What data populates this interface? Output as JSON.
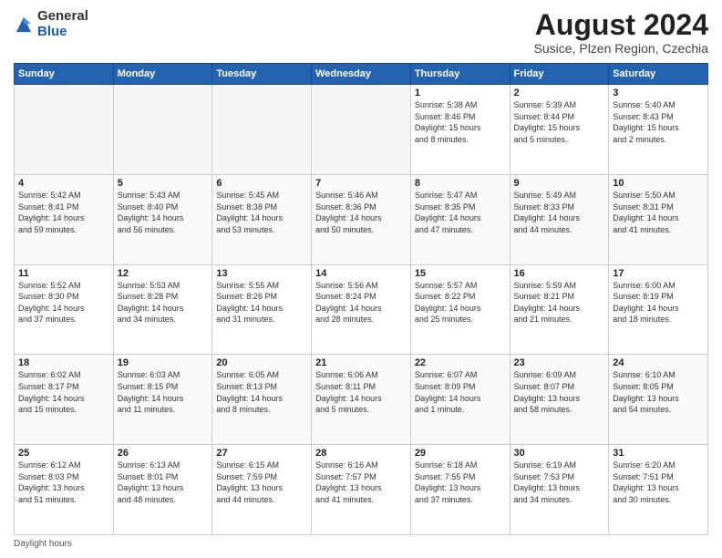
{
  "logo": {
    "general": "General",
    "blue": "Blue"
  },
  "title": "August 2024",
  "subtitle": "Susice, Plzen Region, Czechia",
  "days_of_week": [
    "Sunday",
    "Monday",
    "Tuesday",
    "Wednesday",
    "Thursday",
    "Friday",
    "Saturday"
  ],
  "footer": "Daylight hours",
  "weeks": [
    [
      {
        "day": "",
        "info": ""
      },
      {
        "day": "",
        "info": ""
      },
      {
        "day": "",
        "info": ""
      },
      {
        "day": "",
        "info": ""
      },
      {
        "day": "1",
        "info": "Sunrise: 5:38 AM\nSunset: 8:46 PM\nDaylight: 15 hours\nand 8 minutes."
      },
      {
        "day": "2",
        "info": "Sunrise: 5:39 AM\nSunset: 8:44 PM\nDaylight: 15 hours\nand 5 minutes."
      },
      {
        "day": "3",
        "info": "Sunrise: 5:40 AM\nSunset: 8:43 PM\nDaylight: 15 hours\nand 2 minutes."
      }
    ],
    [
      {
        "day": "4",
        "info": "Sunrise: 5:42 AM\nSunset: 8:41 PM\nDaylight: 14 hours\nand 59 minutes."
      },
      {
        "day": "5",
        "info": "Sunrise: 5:43 AM\nSunset: 8:40 PM\nDaylight: 14 hours\nand 56 minutes."
      },
      {
        "day": "6",
        "info": "Sunrise: 5:45 AM\nSunset: 8:38 PM\nDaylight: 14 hours\nand 53 minutes."
      },
      {
        "day": "7",
        "info": "Sunrise: 5:46 AM\nSunset: 8:36 PM\nDaylight: 14 hours\nand 50 minutes."
      },
      {
        "day": "8",
        "info": "Sunrise: 5:47 AM\nSunset: 8:35 PM\nDaylight: 14 hours\nand 47 minutes."
      },
      {
        "day": "9",
        "info": "Sunrise: 5:49 AM\nSunset: 8:33 PM\nDaylight: 14 hours\nand 44 minutes."
      },
      {
        "day": "10",
        "info": "Sunrise: 5:50 AM\nSunset: 8:31 PM\nDaylight: 14 hours\nand 41 minutes."
      }
    ],
    [
      {
        "day": "11",
        "info": "Sunrise: 5:52 AM\nSunset: 8:30 PM\nDaylight: 14 hours\nand 37 minutes."
      },
      {
        "day": "12",
        "info": "Sunrise: 5:53 AM\nSunset: 8:28 PM\nDaylight: 14 hours\nand 34 minutes."
      },
      {
        "day": "13",
        "info": "Sunrise: 5:55 AM\nSunset: 8:26 PM\nDaylight: 14 hours\nand 31 minutes."
      },
      {
        "day": "14",
        "info": "Sunrise: 5:56 AM\nSunset: 8:24 PM\nDaylight: 14 hours\nand 28 minutes."
      },
      {
        "day": "15",
        "info": "Sunrise: 5:57 AM\nSunset: 8:22 PM\nDaylight: 14 hours\nand 25 minutes."
      },
      {
        "day": "16",
        "info": "Sunrise: 5:59 AM\nSunset: 8:21 PM\nDaylight: 14 hours\nand 21 minutes."
      },
      {
        "day": "17",
        "info": "Sunrise: 6:00 AM\nSunset: 8:19 PM\nDaylight: 14 hours\nand 18 minutes."
      }
    ],
    [
      {
        "day": "18",
        "info": "Sunrise: 6:02 AM\nSunset: 8:17 PM\nDaylight: 14 hours\nand 15 minutes."
      },
      {
        "day": "19",
        "info": "Sunrise: 6:03 AM\nSunset: 8:15 PM\nDaylight: 14 hours\nand 11 minutes."
      },
      {
        "day": "20",
        "info": "Sunrise: 6:05 AM\nSunset: 8:13 PM\nDaylight: 14 hours\nand 8 minutes."
      },
      {
        "day": "21",
        "info": "Sunrise: 6:06 AM\nSunset: 8:11 PM\nDaylight: 14 hours\nand 5 minutes."
      },
      {
        "day": "22",
        "info": "Sunrise: 6:07 AM\nSunset: 8:09 PM\nDaylight: 14 hours\nand 1 minute."
      },
      {
        "day": "23",
        "info": "Sunrise: 6:09 AM\nSunset: 8:07 PM\nDaylight: 13 hours\nand 58 minutes."
      },
      {
        "day": "24",
        "info": "Sunrise: 6:10 AM\nSunset: 8:05 PM\nDaylight: 13 hours\nand 54 minutes."
      }
    ],
    [
      {
        "day": "25",
        "info": "Sunrise: 6:12 AM\nSunset: 8:03 PM\nDaylight: 13 hours\nand 51 minutes."
      },
      {
        "day": "26",
        "info": "Sunrise: 6:13 AM\nSunset: 8:01 PM\nDaylight: 13 hours\nand 48 minutes."
      },
      {
        "day": "27",
        "info": "Sunrise: 6:15 AM\nSunset: 7:59 PM\nDaylight: 13 hours\nand 44 minutes."
      },
      {
        "day": "28",
        "info": "Sunrise: 6:16 AM\nSunset: 7:57 PM\nDaylight: 13 hours\nand 41 minutes."
      },
      {
        "day": "29",
        "info": "Sunrise: 6:18 AM\nSunset: 7:55 PM\nDaylight: 13 hours\nand 37 minutes."
      },
      {
        "day": "30",
        "info": "Sunrise: 6:19 AM\nSunset: 7:53 PM\nDaylight: 13 hours\nand 34 minutes."
      },
      {
        "day": "31",
        "info": "Sunrise: 6:20 AM\nSunset: 7:51 PM\nDaylight: 13 hours\nand 30 minutes."
      }
    ]
  ]
}
